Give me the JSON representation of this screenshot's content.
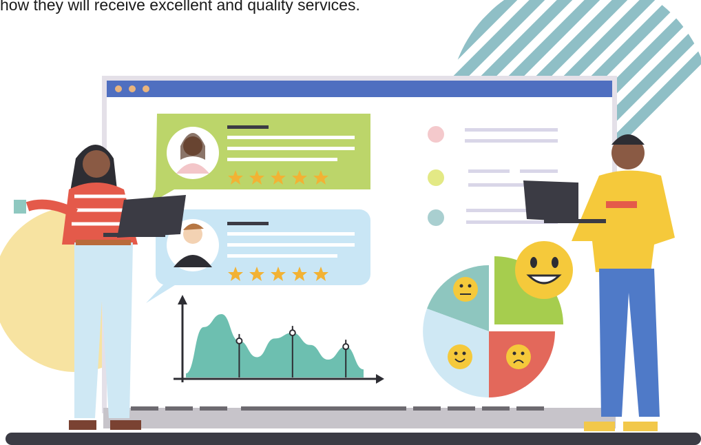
{
  "caption": "how they will receive excellent and quality services.",
  "window": {
    "title_dots": 3,
    "accent": "#4f6fc0",
    "frame_color": "#e4e0e8"
  },
  "reviews": [
    {
      "avatar": "woman-avatar-icon",
      "stars": 5,
      "bubble_color": "#bcd56a"
    },
    {
      "avatar": "man-avatar-icon",
      "stars": 5,
      "bubble_color": "#c9e6f5"
    }
  ],
  "legend_items": [
    {
      "dot_color": "#f4c9cc"
    },
    {
      "dot_color": "#e3e985"
    },
    {
      "dot_color": "#a9cfd0"
    }
  ],
  "chart_data": {
    "type": "area",
    "title": "",
    "xlabel": "",
    "ylabel": "",
    "series": [
      {
        "values": [
          0.05,
          0.62,
          0.78,
          0.45,
          0.25,
          0.48,
          0.55,
          0.4,
          0.22,
          0.38,
          0.1
        ]
      }
    ],
    "markers_at_index": [
      3,
      6,
      9
    ],
    "fill_color": "#6dbfb0",
    "grid": false
  },
  "feedback_pie": {
    "slices": [
      {
        "mood": "happy-face-icon",
        "color": "#a6cd4e"
      },
      {
        "mood": "sad-face-icon",
        "color": "#e3685b"
      },
      {
        "mood": "smile-face-icon",
        "color": "#cfe8f4"
      },
      {
        "mood": "neutral-face-icon",
        "color": "#8ec6bf"
      }
    ]
  }
}
